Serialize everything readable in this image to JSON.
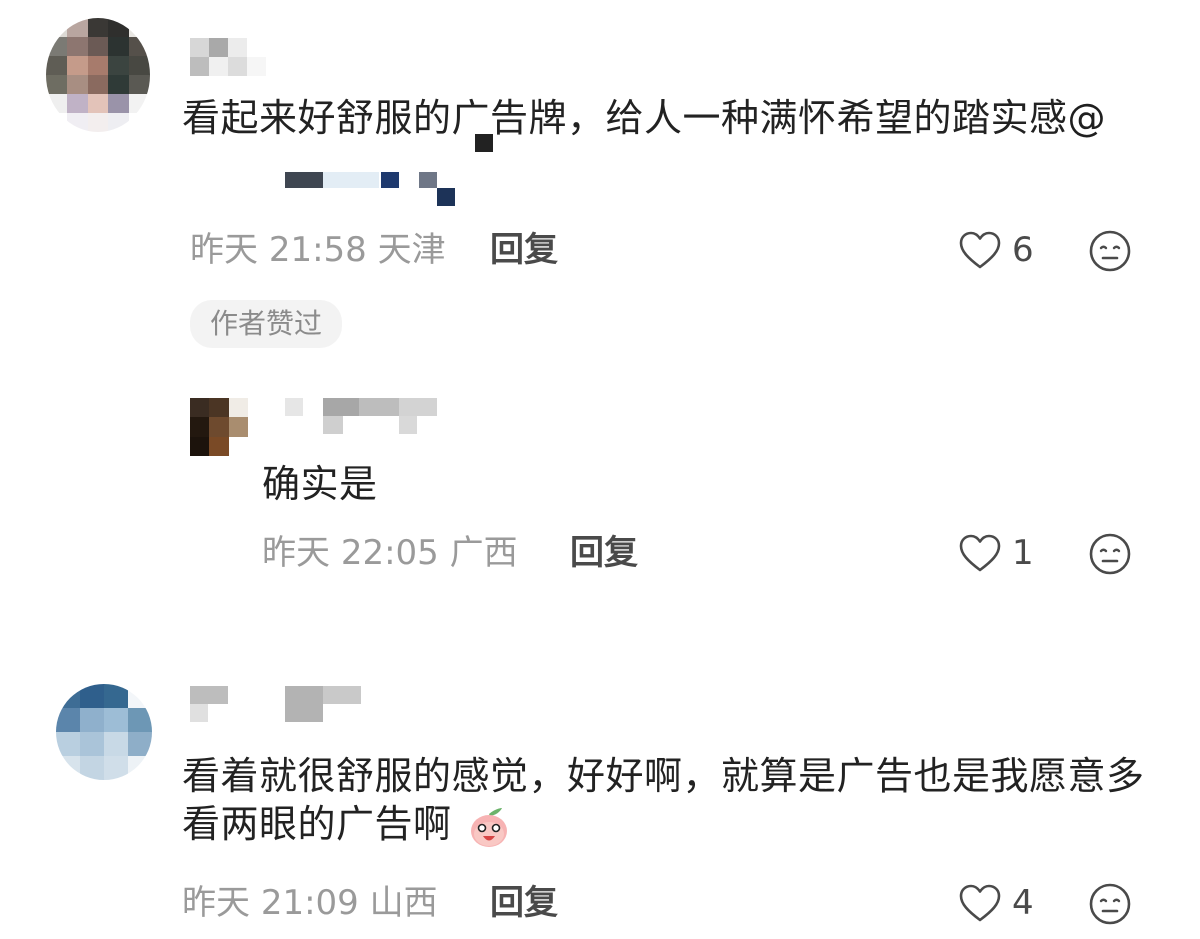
{
  "comments": [
    {
      "text": "看起来好舒服的广告牌，给人一种满怀希望的踏实感",
      "mention": "@",
      "time": "昨天",
      "clock": "21:58",
      "location": "天津",
      "reply_label": "回复",
      "likes": "6",
      "author_badge": "作者赞过",
      "replies": [
        {
          "text": "确实是",
          "time": "昨天",
          "clock": "22:05",
          "location": "广西",
          "reply_label": "回复",
          "likes": "1"
        }
      ]
    },
    {
      "text": "看着就很舒服的感觉，好好啊，就算是广告也是我愿意多看两眼的广告啊",
      "time": "昨天",
      "clock": "21:09",
      "location": "山西",
      "reply_label": "回复",
      "likes": "4",
      "emoji": "peach-emoji"
    }
  ],
  "icons": {
    "like": "heart-outline-icon",
    "more": "neutral-face-icon"
  },
  "colors": {
    "text": "#222222",
    "meta": "#9a9a9a",
    "action": "#4a4a4a",
    "badge_bg": "#f3f3f3"
  }
}
